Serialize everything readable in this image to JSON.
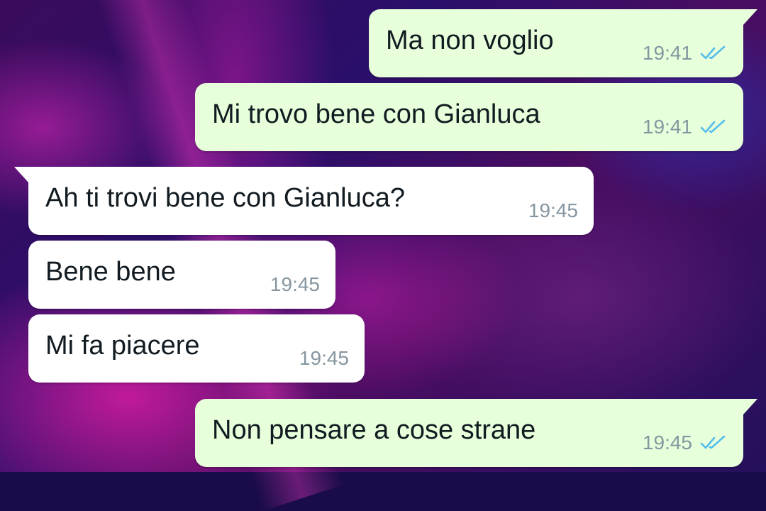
{
  "colors": {
    "outgoing_bubble": "#e7ffdb",
    "incoming_bubble": "#ffffff",
    "read_ticks": "#53bdeb",
    "timestamp": "#8696a0"
  },
  "messages": [
    {
      "direction": "outgoing",
      "text": "Ma non voglio",
      "time": "19:41",
      "status_icon": "double-check-read-icon"
    },
    {
      "direction": "outgoing",
      "text": "Mi trovo bene con Gianluca",
      "time": "19:41",
      "status_icon": "double-check-read-icon"
    },
    {
      "direction": "incoming",
      "text": "Ah ti trovi bene con Gianluca?",
      "time": "19:45"
    },
    {
      "direction": "incoming",
      "text": "Bene bene",
      "time": "19:45"
    },
    {
      "direction": "incoming",
      "text": "Mi fa piacere",
      "time": "19:45"
    },
    {
      "direction": "outgoing",
      "text": "Non pensare a cose strane",
      "time": "19:45",
      "status_icon": "double-check-read-icon"
    }
  ]
}
